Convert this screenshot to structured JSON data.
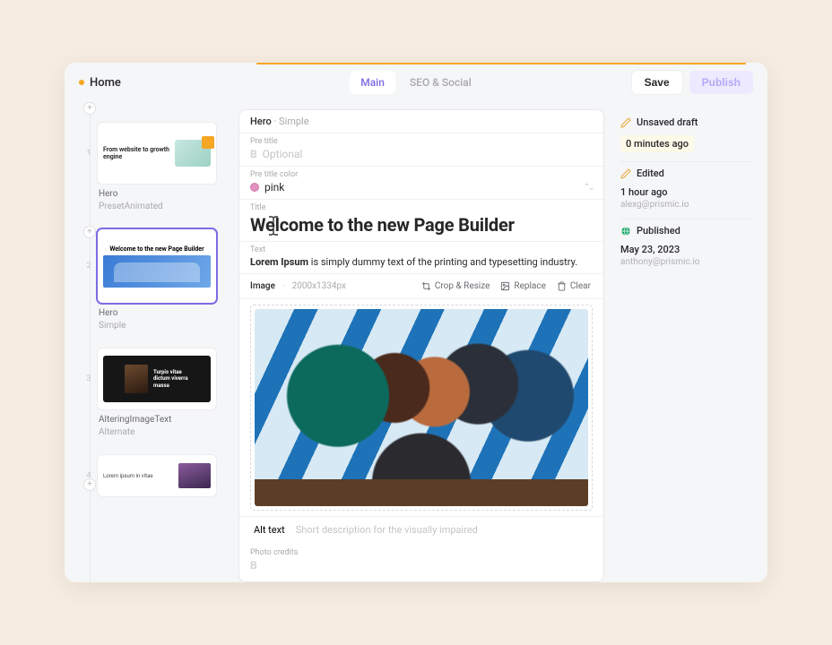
{
  "topbar": {
    "crumb": "Home",
    "tabs": {
      "main": "Main",
      "seo": "SEO & Social"
    },
    "save": "Save",
    "publish": "Publish"
  },
  "slices": [
    {
      "idx": "1",
      "name": "Hero",
      "variant": "PresetAnimated",
      "thumb_headline": "From website to growth engine"
    },
    {
      "idx": "2",
      "name": "Hero",
      "variant": "Simple",
      "thumb_headline": "Welcome to the new Page Builder"
    },
    {
      "idx": "3",
      "name": "AlteringImageText",
      "variant": "Alternate",
      "thumb_headline": "Turpis vitae dictum viverra massa"
    },
    {
      "idx": "4",
      "name": "",
      "variant": "",
      "thumb_headline": "Lorem ipsum in vitae"
    }
  ],
  "editor": {
    "breadcrumb_a": "Hero",
    "breadcrumb_b": "Simple",
    "pre_title_label": "Pre title",
    "pre_title_placeholder": "Optional",
    "pre_color_label": "Pre title color",
    "pre_color_value": "pink",
    "title_label": "Title",
    "title_value": "Welcome to the new Page Builder",
    "text_label": "Text",
    "text_strong": "Lorem Ipsum",
    "text_rest": " is simply dummy text of the printing and typesetting industry.",
    "image_label": "Image",
    "image_dims": "2000x1334px",
    "crop": "Crop & Resize",
    "replace": "Replace",
    "clear": "Clear",
    "alt_label": "Alt text",
    "alt_placeholder": "Short description for the visually impaired",
    "credits_label": "Photo credits"
  },
  "history": {
    "unsaved": "Unsaved draft",
    "unsaved_time": "0 minutes ago",
    "edited": "Edited",
    "edited_time": "1 hour ago",
    "edited_by": "alexg@prismic.io",
    "published": "Published",
    "published_time": "May 23, 2023",
    "published_by": "anthony@prismic.io"
  }
}
